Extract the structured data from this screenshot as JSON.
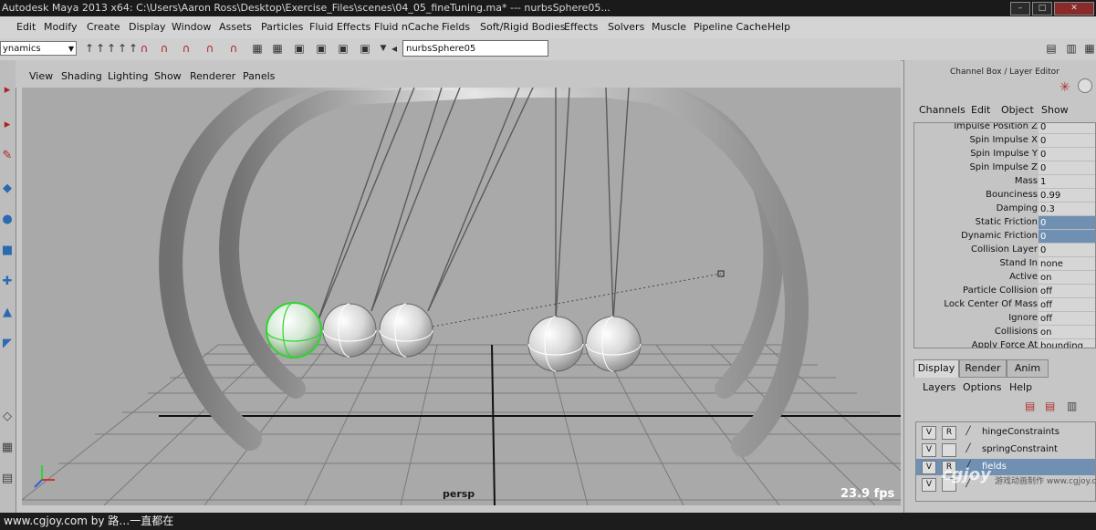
{
  "window": {
    "title": "Autodesk Maya 2013 x64: C:\\Users\\Aaron Ross\\Desktop\\Exercise_Files\\scenes\\04_05_fineTuning.ma*   ---   nurbsSphere05...",
    "minimize_glyph": "–",
    "maximize_glyph": "□",
    "close_glyph": "✕"
  },
  "menu": [
    "Edit",
    "Modify",
    "Create",
    "Display",
    "Window",
    "Assets",
    "Particles",
    "Fluid Effects",
    "Fluid nCache",
    "Fields",
    "Soft/Rigid Bodies",
    "Effects",
    "Solvers",
    "Muscle",
    "Pipeline Cache",
    "Help"
  ],
  "toolbar": {
    "mode_value": "ynamics",
    "name_field_value": "nurbsSphere05",
    "icons": [
      "arrow-icon",
      "arrow-icon",
      "arrow-icon",
      "arrow-icon",
      "arrow-icon",
      "arrow-icon",
      "magnet-icon",
      "magnet-icon",
      "magnet-icon",
      "magnet-icon",
      "magnet-icon",
      "grid-icon",
      "grid-icon",
      "grid-icon",
      "grid-icon",
      "grid-icon",
      "grid-icon"
    ]
  },
  "panel_menu": [
    "View",
    "Shading",
    "Lighting",
    "Show",
    "Renderer",
    "Panels"
  ],
  "viewport": {
    "camera_label": "persp",
    "fps_label": "23.9 fps",
    "colors": {
      "background": "#a9a9a9",
      "grid": "#7a7a7a",
      "grid_axis": "#111111",
      "selected": "#2fd42f"
    }
  },
  "channel_box": {
    "title": "Channel Box / Layer Editor",
    "menus": [
      "Channels",
      "Edit",
      "Object",
      "Show"
    ],
    "attributes": [
      {
        "name": "Impulse Position Z",
        "value": "0",
        "selected": false
      },
      {
        "name": "Spin Impulse X",
        "value": "0",
        "selected": false
      },
      {
        "name": "Spin Impulse Y",
        "value": "0",
        "selected": false
      },
      {
        "name": "Spin Impulse Z",
        "value": "0",
        "selected": false
      },
      {
        "name": "Mass",
        "value": "1",
        "selected": false
      },
      {
        "name": "Bounciness",
        "value": "0.99",
        "selected": false
      },
      {
        "name": "Damping",
        "value": "0.3",
        "selected": false
      },
      {
        "name": "Static Friction",
        "value": "0",
        "selected": true
      },
      {
        "name": "Dynamic Friction",
        "value": "0",
        "selected": true
      },
      {
        "name": "Collision Layer",
        "value": "0",
        "selected": false
      },
      {
        "name": "Stand In",
        "value": "none",
        "selected": false
      },
      {
        "name": "Active",
        "value": "on",
        "selected": false
      },
      {
        "name": "Particle Collision",
        "value": "off",
        "selected": false
      },
      {
        "name": "Lock Center Of Mass",
        "value": "off",
        "selected": false
      },
      {
        "name": "Ignore",
        "value": "off",
        "selected": false
      },
      {
        "name": "Collisions",
        "value": "on",
        "selected": false
      },
      {
        "name": "Apply Force At",
        "value": "bounding",
        "selected": false
      }
    ]
  },
  "layer_editor": {
    "tabs": [
      "Display",
      "Render",
      "Anim"
    ],
    "menus": [
      "Layers",
      "Options",
      "Help"
    ],
    "layers": [
      {
        "v": "V",
        "r": "R",
        "name": "hingeConstraints",
        "selected": false
      },
      {
        "v": "V",
        "r": "",
        "name": "springConstraint",
        "selected": false
      },
      {
        "v": "V",
        "r": "R",
        "name": "fields",
        "selected": true
      },
      {
        "v": "V",
        "r": "",
        "name": "",
        "selected": false
      }
    ]
  },
  "footer": {
    "credit": "www.cgjoy.com by 路…一直都在"
  },
  "watermark": {
    "logo": "cgjoy",
    "subtitle": "游戏动画制作 www.cgjoy.com"
  }
}
